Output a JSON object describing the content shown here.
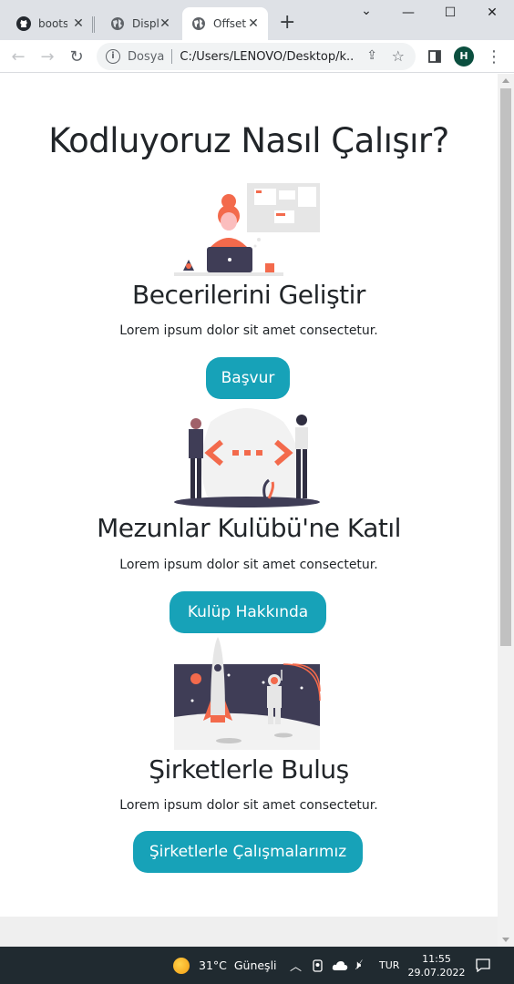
{
  "browser": {
    "tabs": [
      {
        "title": "bootstrap",
        "icon": "github-icon"
      },
      {
        "title": "Display",
        "icon": "globe-icon"
      },
      {
        "title": "Offset",
        "icon": "globe-icon",
        "active": true
      }
    ],
    "address": {
      "security_label": "Dosya",
      "url": "C:/Users/LENOVO/Desktop/k..."
    },
    "profile_initial": "H"
  },
  "page": {
    "heading": "Kodluyoruz Nasıl Çalışır?",
    "sections": [
      {
        "title": "Becerilerini Geliştir",
        "text": "Lorem ipsum dolor sit amet consectetur.",
        "button": "Başvur"
      },
      {
        "title": "Mezunlar Kulübü'ne Katıl",
        "text": "Lorem ipsum dolor sit amet consectetur.",
        "button": "Kulüp Hakkında"
      },
      {
        "title": "Şirketlerle Buluş",
        "text": "Lorem ipsum dolor sit amet consectetur.",
        "button": "Şirketlerle Çalışmalarımız"
      }
    ],
    "button_color": "#17a2b8"
  },
  "taskbar": {
    "weather": "31°C  Güneşli",
    "language": "TUR",
    "time": "11:55",
    "date": "29.07.2022"
  }
}
